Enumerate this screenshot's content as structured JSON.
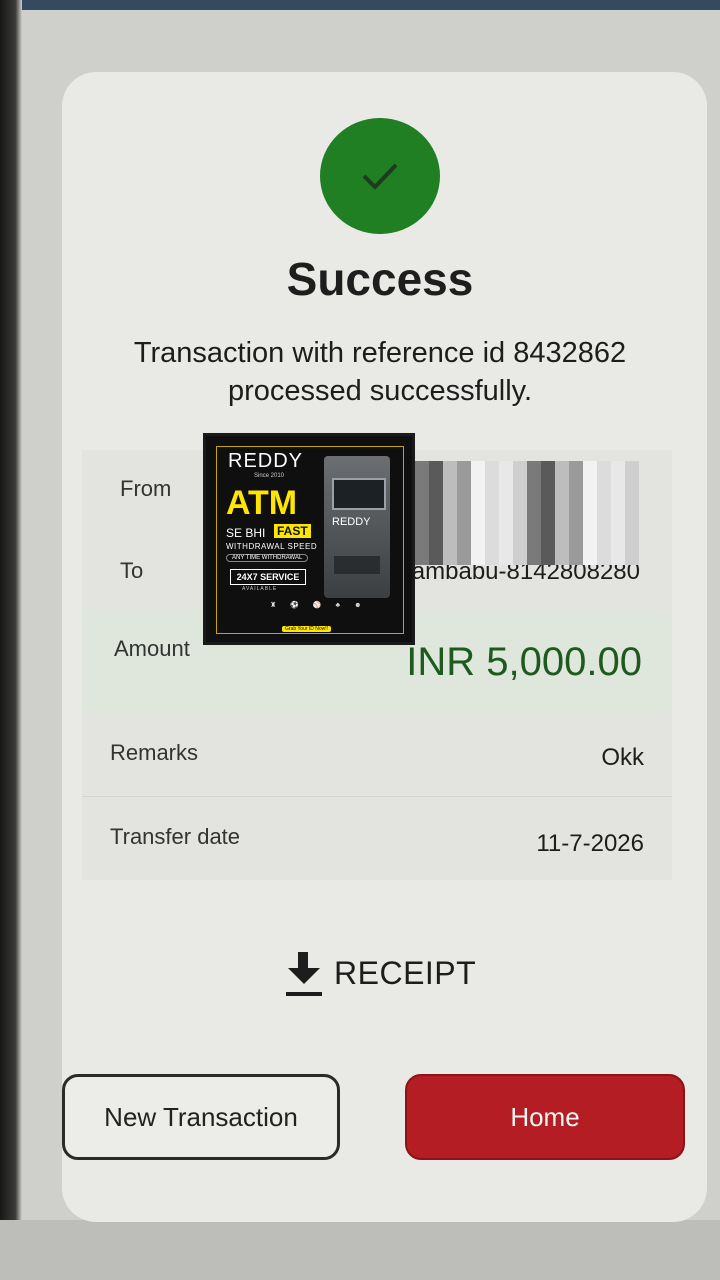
{
  "status": {
    "title": "Success",
    "message": "Transaction with reference id 8432862 processed successfully.",
    "icon": "checkmark-icon",
    "accent_color": "#1f7f22"
  },
  "details": {
    "from_label": "From",
    "to_label": "To",
    "to_value": "ambabu-8142808280",
    "amount_label": "Amount",
    "amount_value": "INR 5,000.00",
    "remarks_label": "Remarks",
    "remarks_value": "Okk",
    "date_label": "Transfer date",
    "date_value": "11-7-2026"
  },
  "ad": {
    "brand": "REDDY",
    "since": "Since 2010",
    "headline": "ATM",
    "line1": "SE BHI",
    "fast": "FAST",
    "line2": "WITHDRAWAL SPEED",
    "line3": "ANY TIME WITHDRAWAL",
    "service": "24X7 SERVICE",
    "available": "AVAILABLE",
    "machine_brand": "REDDY",
    "cta": "Grab Your ID Now!!"
  },
  "receipt": {
    "label": "RECEIPT",
    "icon": "download-icon"
  },
  "buttons": {
    "new_transaction": "New Transaction",
    "home": "Home",
    "home_color": "#b31d23"
  }
}
